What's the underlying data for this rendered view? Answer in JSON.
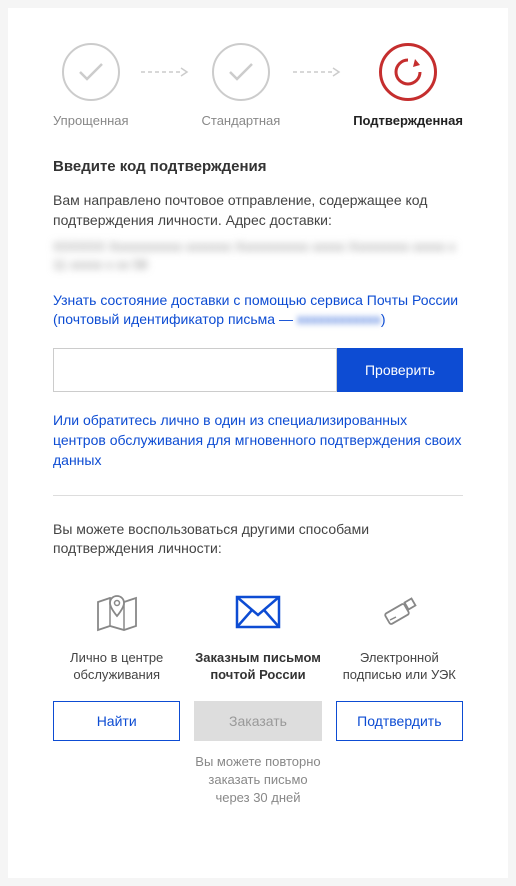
{
  "steps": {
    "simplified": "Упрощенная",
    "standard": "Стандартная",
    "confirmed": "Подтвержденная"
  },
  "title": "Введите код подтверждения",
  "description": "Вам направлено почтовое отправление, содержащее код подтверждения личности. Адрес доставки:",
  "address_hidden": "XXXXXX Xxxxxxxxxxx xxxxxxx Xxxxxxxxxxx xxxxx Xxxxxxxxx xxxxx x 11 xxxxx x xx 58",
  "delivery_link_part1": "Узнать состояние доставки с помощью сервиса Почты России (почтовый идентификатор письма — ",
  "delivery_link_id": "xxxxxxxxxxxx",
  "delivery_link_part2": ")",
  "check_button": "Проверить",
  "alt_link": "Или обратитесь лично в один из специализированных центров обслуживания для мгновенного подтверждения своих данных",
  "other_methods_title": "Вы можете воспользоваться другими способами подтверждения личности:",
  "methods": {
    "center": {
      "label": "Лично в центре обслуживания",
      "button": "Найти"
    },
    "mail": {
      "label": "Заказным письмом почтой России",
      "button": "Заказать",
      "note": "Вы можете повторно заказать письмо через 30 дней"
    },
    "signature": {
      "label": "Электронной подписью или УЭК",
      "button": "Подтвердить"
    }
  }
}
